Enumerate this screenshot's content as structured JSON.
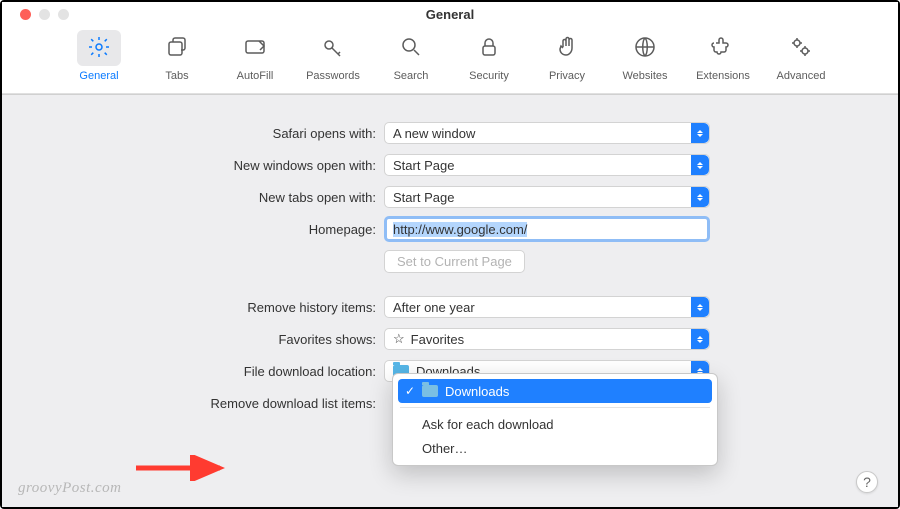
{
  "window": {
    "title": "General"
  },
  "toolbar": {
    "items": [
      {
        "id": "general",
        "label": "General"
      },
      {
        "id": "tabs",
        "label": "Tabs"
      },
      {
        "id": "autofill",
        "label": "AutoFill"
      },
      {
        "id": "passwords",
        "label": "Passwords"
      },
      {
        "id": "search",
        "label": "Search"
      },
      {
        "id": "security",
        "label": "Security"
      },
      {
        "id": "privacy",
        "label": "Privacy"
      },
      {
        "id": "websites",
        "label": "Websites"
      },
      {
        "id": "extensions",
        "label": "Extensions"
      },
      {
        "id": "advanced",
        "label": "Advanced"
      }
    ]
  },
  "form": {
    "safari_opens": {
      "label": "Safari opens with:",
      "value": "A new window"
    },
    "new_windows": {
      "label": "New windows open with:",
      "value": "Start Page"
    },
    "new_tabs": {
      "label": "New tabs open with:",
      "value": "Start Page"
    },
    "homepage": {
      "label": "Homepage:",
      "value": "http://www.google.com/"
    },
    "set_current": {
      "label": "Set to Current Page"
    },
    "remove_history": {
      "label": "Remove history items:",
      "value": "After one year"
    },
    "favorites": {
      "label": "Favorites shows:",
      "value": "Favorites"
    },
    "download_loc": {
      "label": "File download location:",
      "value": "Downloads"
    },
    "remove_dl": {
      "label": "Remove download list items:"
    }
  },
  "dropdown": {
    "options": [
      {
        "label": "Downloads",
        "selected": true,
        "has_folder": true
      },
      {
        "label": "Ask for each download"
      },
      {
        "label": "Other…"
      }
    ]
  },
  "watermark": "groovyPost.com",
  "help": "?"
}
